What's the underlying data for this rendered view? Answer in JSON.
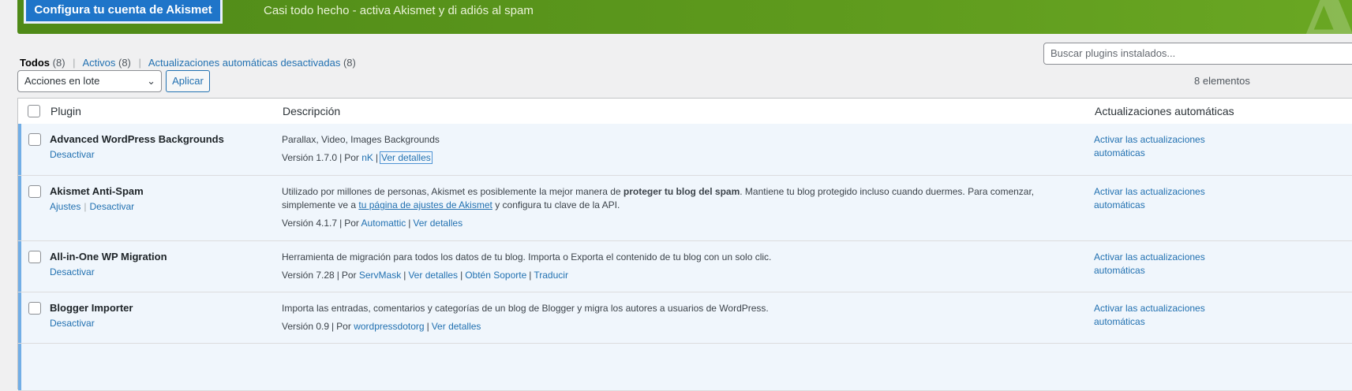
{
  "banner": {
    "button_label": "Configura tu cuenta de Akismet",
    "message": "Casi todo hecho - activa Akismet y di adiós al spam",
    "mark": "A"
  },
  "filters": {
    "all_label": "Todos",
    "all_count": "(8)",
    "active_label": "Activos",
    "active_count": "(8)",
    "auto_off_label": "Actualizaciones automáticas desactivadas",
    "auto_off_count": "(8)"
  },
  "search": {
    "placeholder": "Buscar plugins instalados..."
  },
  "bulk": {
    "selected": "Acciones en lote",
    "apply_label": "Aplicar"
  },
  "items_count": "8 elementos",
  "table": {
    "headers": {
      "plugin": "Plugin",
      "description": "Descripción",
      "auto_updates": "Actualizaciones automáticas"
    },
    "rows": [
      {
        "name": "Advanced WordPress Backgrounds",
        "deactivate": "Desactivar",
        "desc": "Parallax, Video, Images Backgrounds",
        "version": "Versión 1.7.0",
        "by": "Por",
        "author": "nK",
        "details": "Ver detalles",
        "auto": "Activar las actualizaciones automáticas"
      },
      {
        "name": "Akismet Anti-Spam",
        "settings": "Ajustes",
        "deactivate": "Desactivar",
        "desc_1": "Utilizado por millones de personas, Akismet es posiblemente la mejor manera de",
        "desc_bold": "proteger tu blog del spam",
        "desc_2": ". Mantiene tu blog protegido incluso cuando duermes. Para comenzar, simplemente ve a",
        "desc_link": "tu página de ajustes de Akismet",
        "desc_3": "y configura tu clave de la API.",
        "version": "Versión 4.1.7",
        "by": "Por",
        "author": "Automattic",
        "details": "Ver detalles",
        "auto": "Activar las actualizaciones automáticas"
      },
      {
        "name": "All-in-One WP Migration",
        "deactivate": "Desactivar",
        "desc": "Herramienta de migración para todos los datos de tu blog. Importa o Exporta el contenido de tu blog con un solo clic.",
        "version": "Versión 7.28",
        "by": "Por",
        "author": "ServMask",
        "details": "Ver detalles",
        "support": "Obtén Soporte",
        "translate": "Traducir",
        "auto": "Activar las actualizaciones automáticas"
      },
      {
        "name": "Blogger Importer",
        "deactivate": "Desactivar",
        "desc": "Importa las entradas, comentarios y categorías de un blog de Blogger y migra los autores a usuarios de WordPress.",
        "version": "Versión 0.9",
        "by": "Por",
        "author": "wordpressdotorg",
        "details": "Ver detalles",
        "auto": "Activar las actualizaciones automáticas"
      }
    ]
  },
  "colors": {
    "accent": "#72aee6",
    "link": "#2271b1",
    "banner_green": "#5e9a1d",
    "button_blue": "#1f75c9"
  }
}
